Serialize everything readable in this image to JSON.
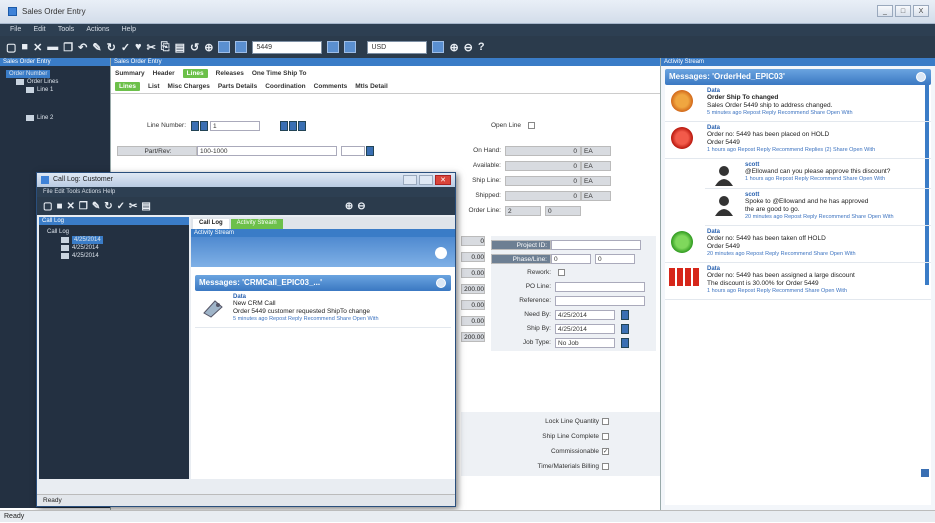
{
  "window": {
    "title": "Sales Order Entry",
    "controls": [
      "_",
      "□",
      "X"
    ]
  },
  "menu": {
    "items": [
      "File",
      "Edit",
      "Tools",
      "Actions",
      "Help"
    ]
  },
  "toolbar": {
    "order_value": "5449",
    "currency_value": "USD"
  },
  "left_panel": {
    "header": "Sales Order Entry",
    "tree": [
      "Order Number",
      "Order Lines",
      "Line 1",
      "Line 2"
    ]
  },
  "main": {
    "header": "Sales Order Entry",
    "top_tabs": [
      "Summary",
      "Header",
      "Lines",
      "Releases",
      "One Time Ship To"
    ],
    "sub_tabs": [
      "Lines",
      "List",
      "Misc Charges",
      "Parts Details",
      "Coordination",
      "Comments",
      "Mtls Detail"
    ],
    "line_number_label": "Line Number:",
    "line_number_value": "1",
    "open_line_label": "Open Line",
    "part_label": "Part/Rev:",
    "part_value": "100-1000",
    "qty_fields": [
      {
        "label": "On Hand:",
        "value": "0",
        "unit": "EA"
      },
      {
        "label": "Available:",
        "value": "0",
        "unit": "EA"
      },
      {
        "label": "Ship Line:",
        "value": "0",
        "unit": "EA"
      },
      {
        "label": "Shipped:",
        "value": "0",
        "unit": "EA"
      }
    ],
    "order_line_label": "Order Line:",
    "order_line_values": [
      "2",
      "0"
    ],
    "right_fields": [
      {
        "label": "Project ID:",
        "value": ""
      },
      {
        "label": "Phase/Line:",
        "value": "0",
        "extra": "0"
      },
      {
        "label": "Rework:",
        "value": ""
      },
      {
        "label": "PO Line:",
        "value": ""
      },
      {
        "label": "Reference:",
        "value": ""
      },
      {
        "label": "Need By:",
        "value": "4/25/2014"
      },
      {
        "label": "Ship By:",
        "value": "4/25/2014"
      },
      {
        "label": "Job Type:",
        "value": "No Job"
      }
    ],
    "amounts": [
      "0",
      "0.00",
      "0.00",
      "200.00",
      "0.00",
      "0.00",
      "200.00",
      "0.00"
    ],
    "checkboxes": [
      {
        "label": "Lock Line Quantity",
        "checked": ""
      },
      {
        "label": "Ship Line Complete",
        "checked": ""
      },
      {
        "label": "Commissionable",
        "checked": "✓"
      },
      {
        "label": "Time/Materials Billing",
        "checked": ""
      }
    ]
  },
  "activity": {
    "header": "Activity Stream",
    "title": "Messages: 'OrderHed_EPIC03'",
    "posts": [
      {
        "name": "Data",
        "lines": [
          "Order Ship To changed",
          "Sales Order 5449 ship to address changed."
        ],
        "meta": "5 minutes ago  Repost  Reply  Recommend  Share  Open With"
      },
      {
        "name": "Data",
        "lines": [
          "Order no: 5449 has been placed on HOLD",
          "Order 5449"
        ],
        "meta": "1 hours ago  Repost  Reply  Recommend  Replies (2)  Share  Open With"
      },
      {
        "name": "scott",
        "lines": [
          "@Ellowand can you please approve this discount?"
        ],
        "meta": "1 hours ago  Repost  Reply  Recommend  Share  Open With"
      },
      {
        "name": "scott",
        "lines": [
          "Spoke to @Ellowand and he has approved",
          "the are good to go."
        ],
        "meta": "20 minutes ago  Repost  Reply  Recommend  Share  Open With"
      },
      {
        "name": "Data",
        "lines": [
          "Order no: 5449 has been taken off HOLD",
          "Order 5449"
        ],
        "meta": "20 minutes ago  Repost  Reply  Recommend  Share  Open With"
      },
      {
        "name": "Data",
        "lines": [
          "Order no: 5449 has been assigned a large discount",
          "The discount is 30.00% for Order 5449"
        ],
        "meta": "1 hours ago  Repost  Reply  Recommend  Share  Open With"
      }
    ]
  },
  "dialog": {
    "title": "Call Log: Customer",
    "menu": "File  Edit  Tools  Actions  Help",
    "tree_header": "Call Log",
    "tree": [
      "Call Log",
      "4/25/2014",
      "4/25/2014",
      "4/25/2014"
    ],
    "tabs": [
      "Call Log",
      "Activity Stream"
    ],
    "stream_header": "Activity Stream",
    "messages_title": "Messages: 'CRMCall_EPIC03_...'",
    "post": {
      "name": "Data",
      "title": "New CRM Call",
      "text": "Order 5449 customer requested ShipTo change",
      "meta": "5 minutes ago  Repost  Reply  Recommend  Share  Open With"
    },
    "status": "Ready"
  },
  "status_bar": "Ready",
  "colors": {
    "accent": "#3a7cc7",
    "dark": "#2b3b4c",
    "green": "#6cc04a"
  }
}
